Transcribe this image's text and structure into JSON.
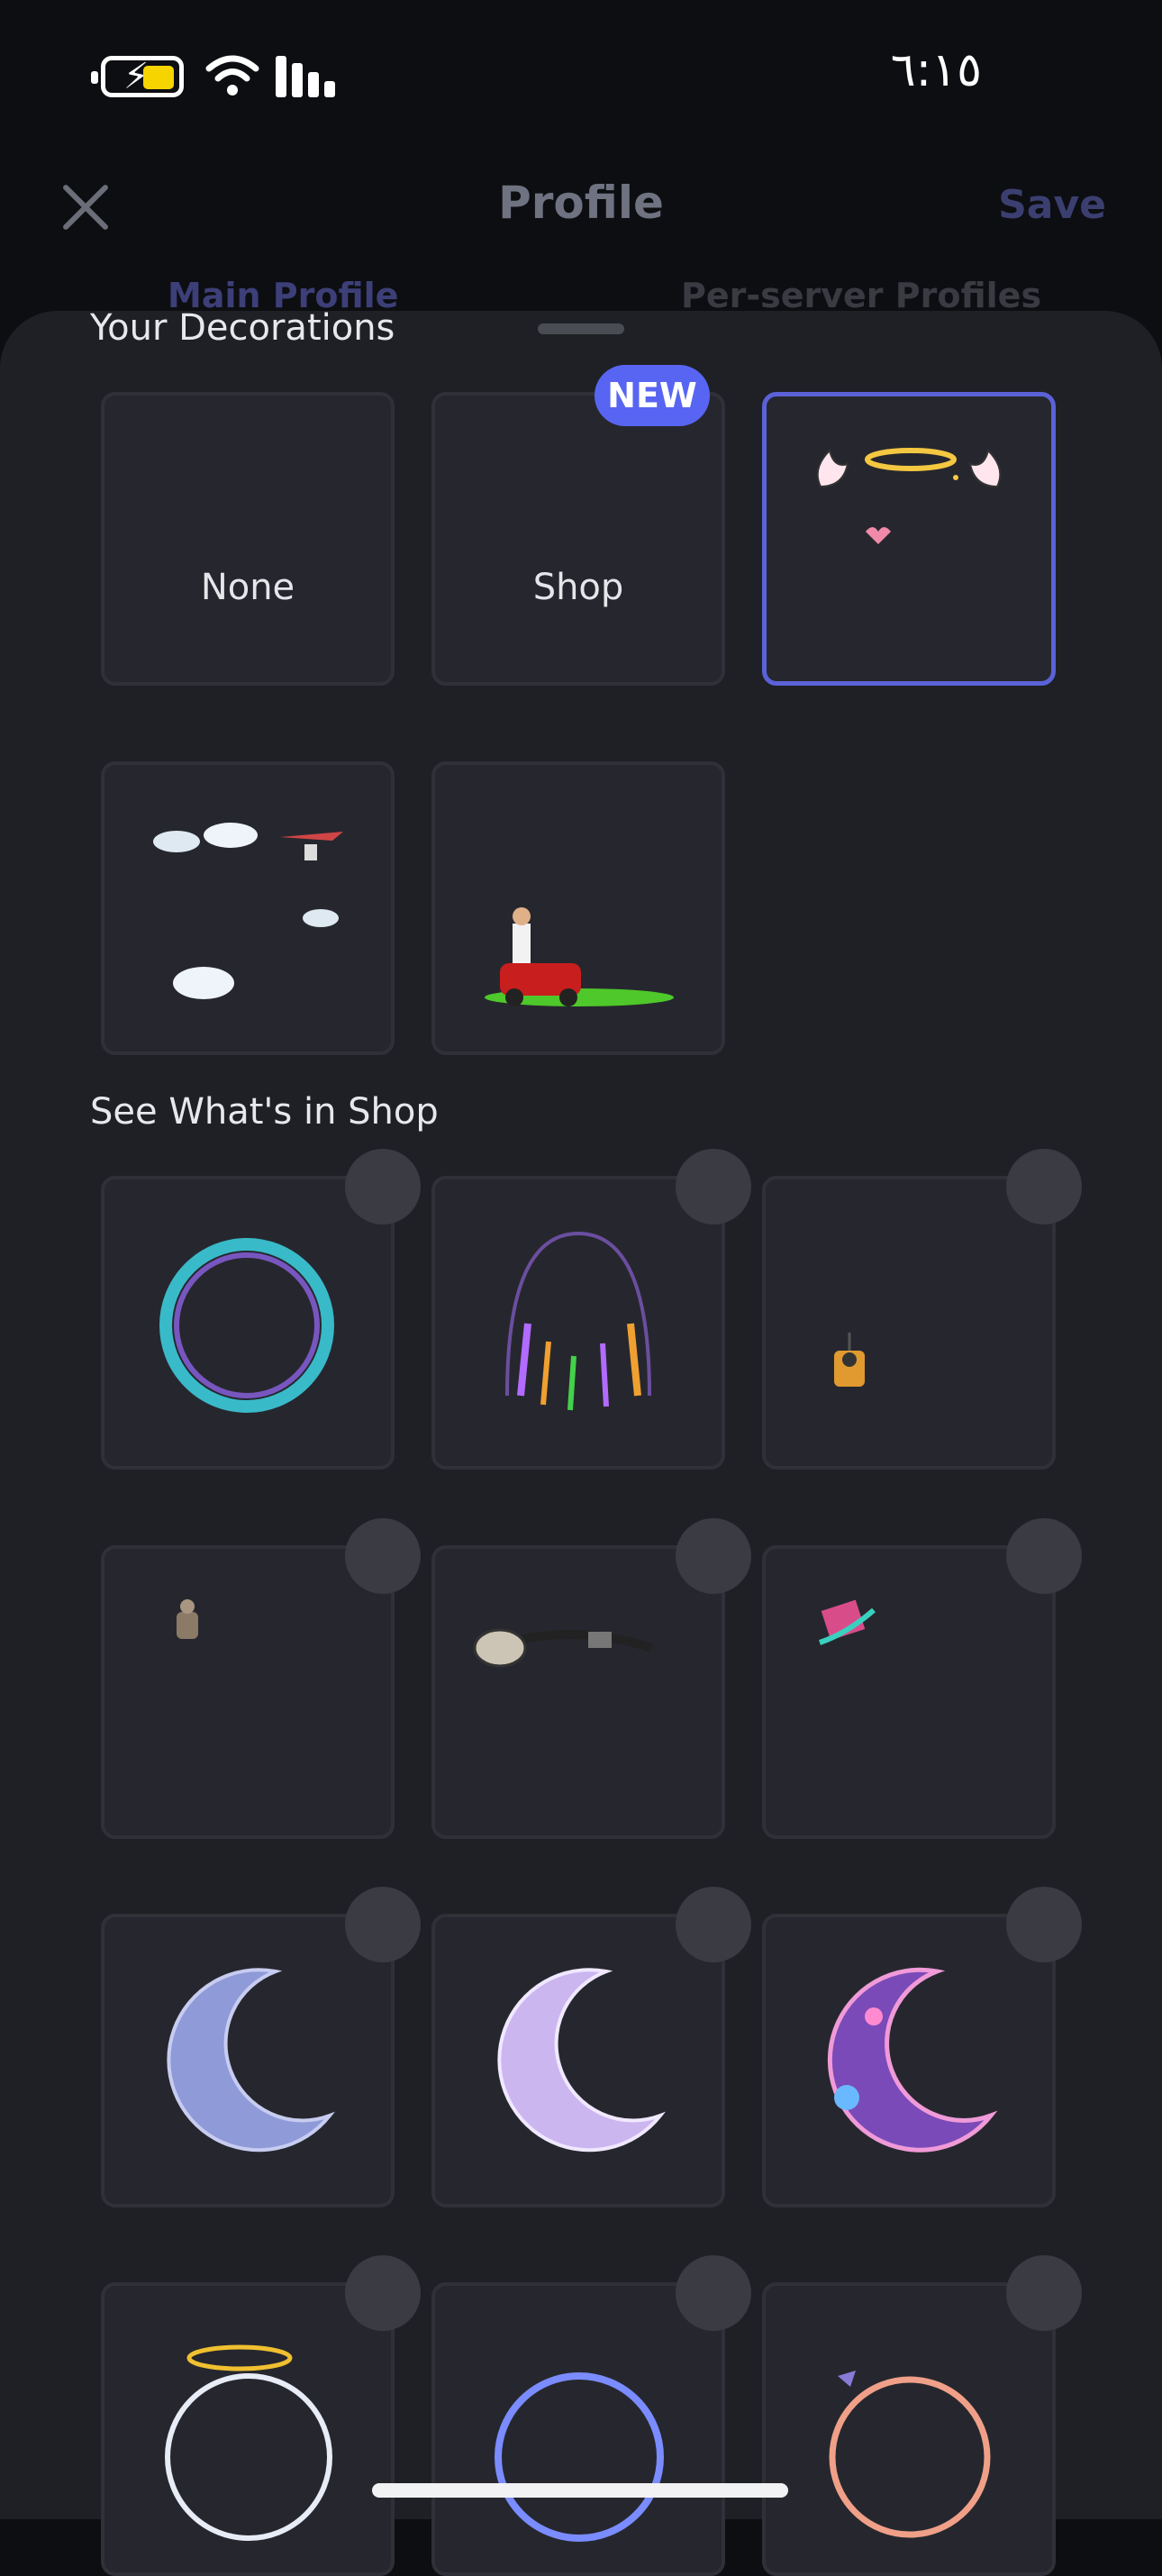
{
  "status_bar": {
    "time": "٦:١٥"
  },
  "header": {
    "title": "Profile",
    "save_label": "Save"
  },
  "tabs": [
    {
      "label": "Main Profile"
    },
    {
      "label": "Per-server Profiles"
    }
  ],
  "your_decorations": {
    "title": "Your Decorations",
    "none_label": "None",
    "shop_label": "Shop",
    "new_badge": "NEW"
  },
  "shop": {
    "title": "See What's in Shop"
  },
  "colors": {
    "accent": "#5865f2",
    "background": "#1f2025",
    "card": "#26272e"
  },
  "icons": [
    "close-icon",
    "battery-icon",
    "wifi-icon",
    "signal-icon"
  ]
}
